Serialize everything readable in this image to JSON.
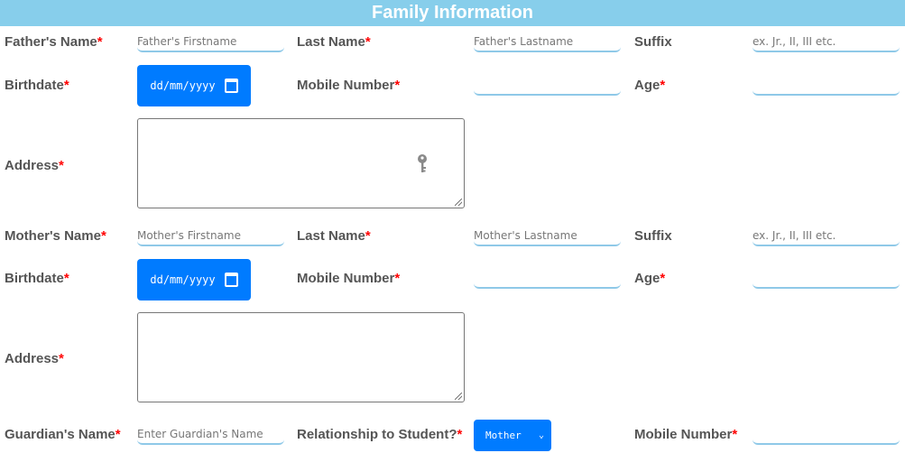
{
  "header": {
    "title": "Family Information"
  },
  "father": {
    "name_label": "Father's Name",
    "firstname_placeholder": "Father's Firstname",
    "lastname_label": "Last Name",
    "lastname_placeholder": "Father's Lastname",
    "suffix_label": "Suffix",
    "suffix_placeholder": "ex. Jr., II, III etc.",
    "birthdate_label": "Birthdate",
    "birthdate_value": "dd/mm/yyyy",
    "mobile_label": "Mobile Number",
    "age_label": "Age",
    "address_label": "Address"
  },
  "mother": {
    "name_label": "Mother's Name",
    "firstname_placeholder": "Mother's Firstname",
    "lastname_label": "Last Name",
    "lastname_placeholder": "Mother's Lastname",
    "suffix_label": "Suffix",
    "suffix_placeholder": "ex. Jr., II, III etc.",
    "birthdate_label": "Birthdate",
    "birthdate_value": "dd/mm/yyyy",
    "mobile_label": "Mobile Number",
    "age_label": "Age",
    "address_label": "Address"
  },
  "guardian": {
    "name_label": "Guardian's Name",
    "name_placeholder": "Enter Guardian's Name",
    "relationship_label": "Relationship to Student?",
    "relationship_value": "Mother",
    "mobile_label": "Mobile Number"
  },
  "required_mark": "*",
  "colors": {
    "header_bg": "#87ceeb",
    "accent": "#007bff",
    "required": "#ff0000",
    "underline": "#8fc9e8"
  },
  "icons": {
    "key": "key-icon",
    "calendar": "calendar-icon",
    "dropdown": "chevron-down-icon"
  }
}
